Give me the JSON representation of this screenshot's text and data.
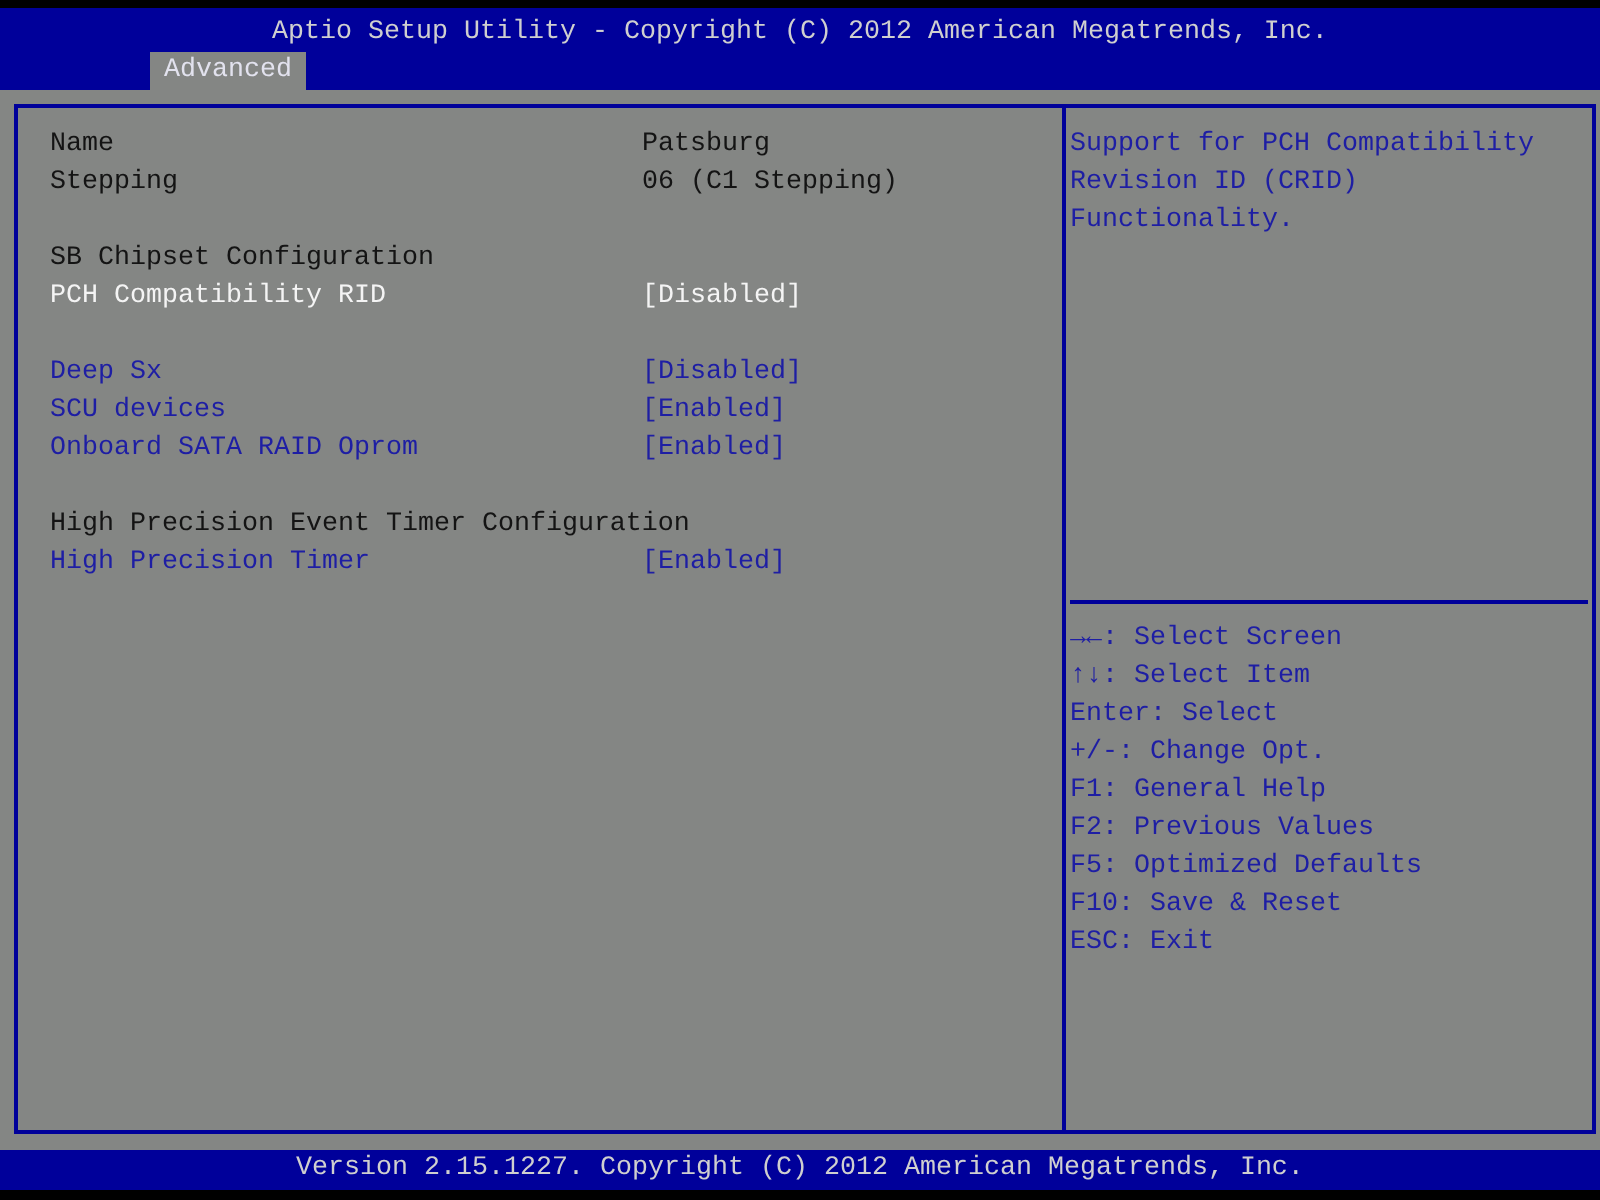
{
  "window": {
    "title": "Aptio Setup Utility - Copyright (C) 2012 American Megatrends, Inc."
  },
  "tabs": [
    {
      "label": "Advanced",
      "selected": true
    }
  ],
  "groups": [
    {
      "items": [
        {
          "kind": "info",
          "label": "Name",
          "value": "Patsburg",
          "selected": false
        },
        {
          "kind": "info",
          "label": "Stepping",
          "value": "06 (C1 Stepping)",
          "selected": false
        }
      ]
    },
    {
      "title": "SB Chipset Configuration",
      "items": [
        {
          "kind": "setting",
          "label": "PCH Compatibility RID",
          "value": "[Disabled]",
          "selected": true
        }
      ]
    },
    {
      "items": [
        {
          "kind": "setting",
          "label": "Deep Sx",
          "value": "[Disabled]",
          "selected": false
        },
        {
          "kind": "setting",
          "label": "SCU devices",
          "value": "[Enabled]",
          "selected": false
        },
        {
          "kind": "setting",
          "label": "Onboard SATA RAID Oprom",
          "value": "[Enabled]",
          "selected": false
        }
      ]
    },
    {
      "title": "High Precision Event Timer Configuration",
      "items": [
        {
          "kind": "setting",
          "label": "High Precision Timer",
          "value": "[Enabled]",
          "selected": false
        }
      ]
    }
  ],
  "help": {
    "description": "Support for PCH Compatibility Revision ID (CRID) Functionality.",
    "keys": [
      "→←: Select Screen",
      "↑↓: Select Item",
      "Enter: Select",
      "+/-: Change Opt.",
      "F1: General Help",
      "F2: Previous Values",
      "F5: Optimized Defaults",
      "F10: Save & Reset",
      "ESC: Exit"
    ]
  },
  "status_bar": {
    "text": "Version 2.15.1227. Copyright (C) 2012 American Megatrends, Inc."
  }
}
